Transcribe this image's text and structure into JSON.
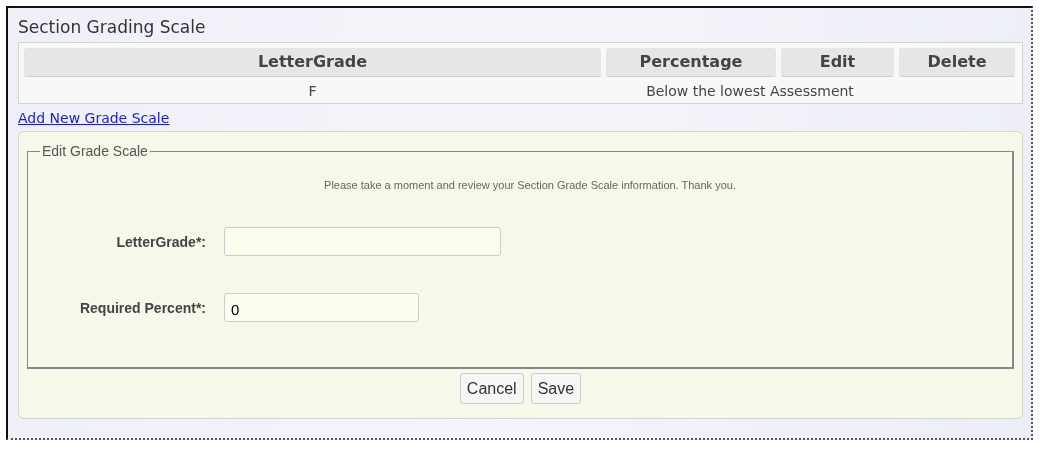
{
  "title": "Section Grading Scale",
  "table": {
    "columns": [
      "LetterGrade",
      "Percentage",
      "Edit",
      "Delete"
    ],
    "rows": [
      {
        "letter_grade": "F",
        "percentage": "Below the lowest Assessment"
      }
    ]
  },
  "add_link": "Add New Grade Scale",
  "form": {
    "legend": "Edit Grade Scale",
    "message": "Please take a moment and review your Section Grade Scale information. Thank you.",
    "fields": [
      {
        "label": "LetterGrade*:"
      },
      {
        "label": "Required Percent*:",
        "value": "0"
      }
    ],
    "buttons": [
      "Cancel",
      "Save"
    ]
  }
}
